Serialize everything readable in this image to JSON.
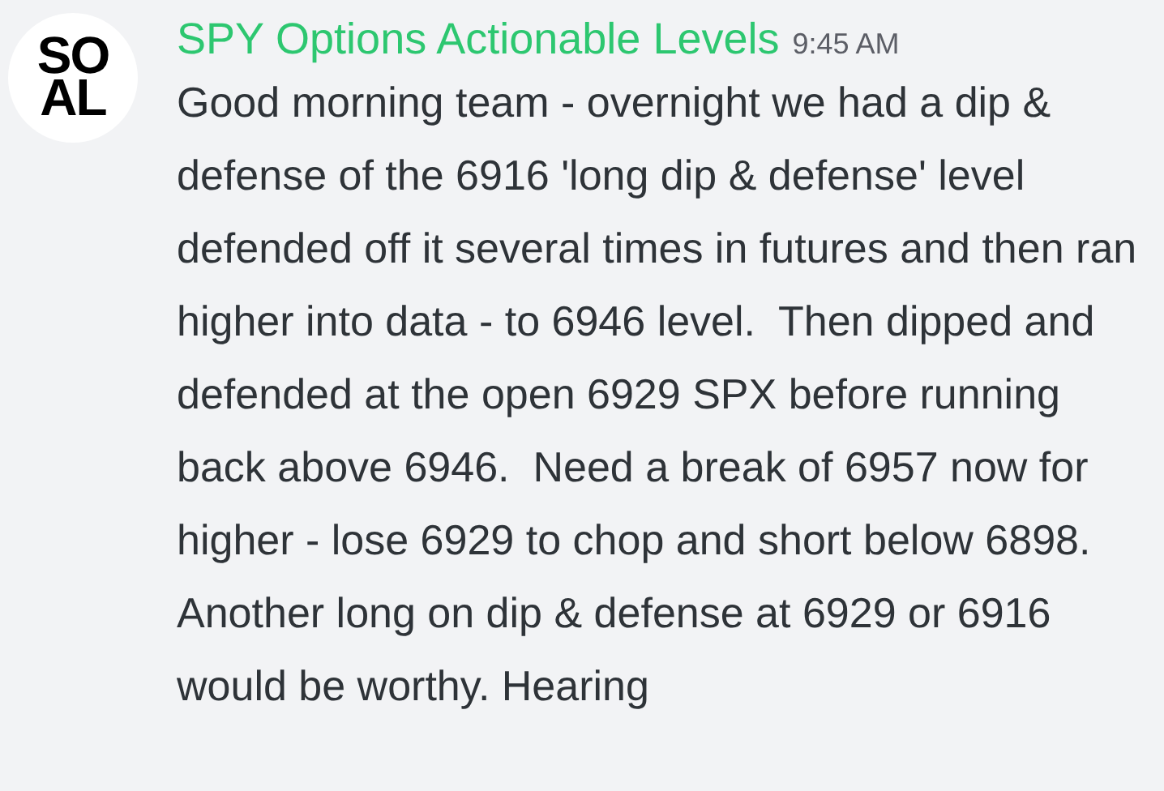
{
  "message": {
    "avatar_lines": [
      "SO",
      "AL"
    ],
    "author": "SPY Options Actionable Levels",
    "time": "9:45 AM",
    "text": "Good morning team - overnight we had a dip & defense of the 6916 'long dip & defense' level defended off it several times in futures and then ran higher into data - to 6946 level.  Then dipped and defended at the open 6929 SPX before running back above 6946.  Need a break of 6957 now for higher - lose 6929 to chop and short below 6898.  Another long on dip & defense at 6929 or 6916 would be worthy. Hearing"
  }
}
